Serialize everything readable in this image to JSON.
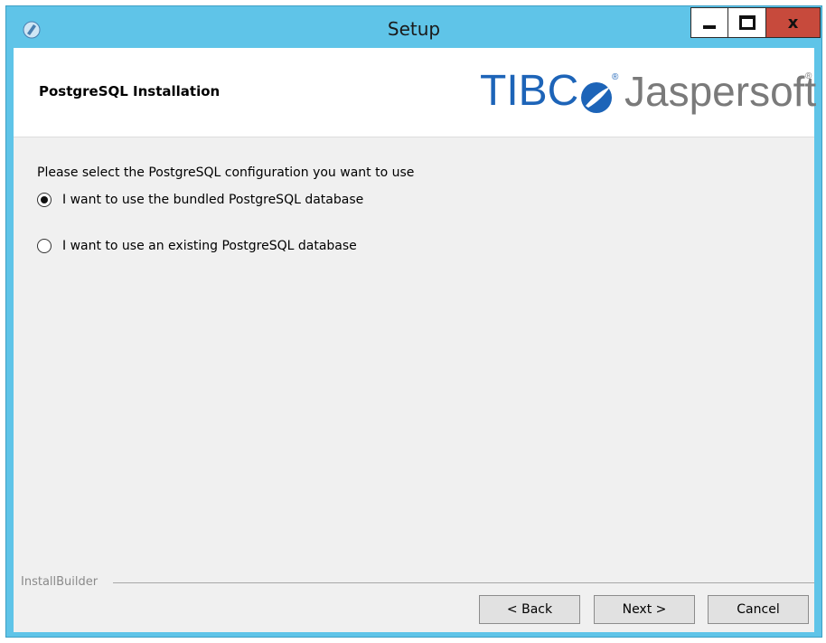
{
  "window": {
    "title": "Setup",
    "close_glyph": "x"
  },
  "header": {
    "page_title": "PostgreSQL Installation",
    "logo_tibco": "TIBC",
    "logo_registered": "®",
    "logo_jaspersoft": "Jaspersoft"
  },
  "main": {
    "prompt": "Please select the PostgreSQL configuration you want to use",
    "options": [
      {
        "label": "I want to use the bundled PostgreSQL database",
        "selected": true
      },
      {
        "label": "I want to use an existing PostgreSQL database",
        "selected": false
      }
    ]
  },
  "footer": {
    "brand": "InstallBuilder",
    "back_label": "< Back",
    "next_label": "Next >",
    "cancel_label": "Cancel"
  },
  "colors": {
    "titlebar": "#5fc4e8",
    "close_button": "#c74a3c",
    "logo_blue": "#1d64b8",
    "logo_gray": "#7a7a7a"
  },
  "icons": [
    "app-icon",
    "minimize-icon",
    "maximize-icon",
    "close-icon",
    "tibco-swoosh-logo"
  ]
}
